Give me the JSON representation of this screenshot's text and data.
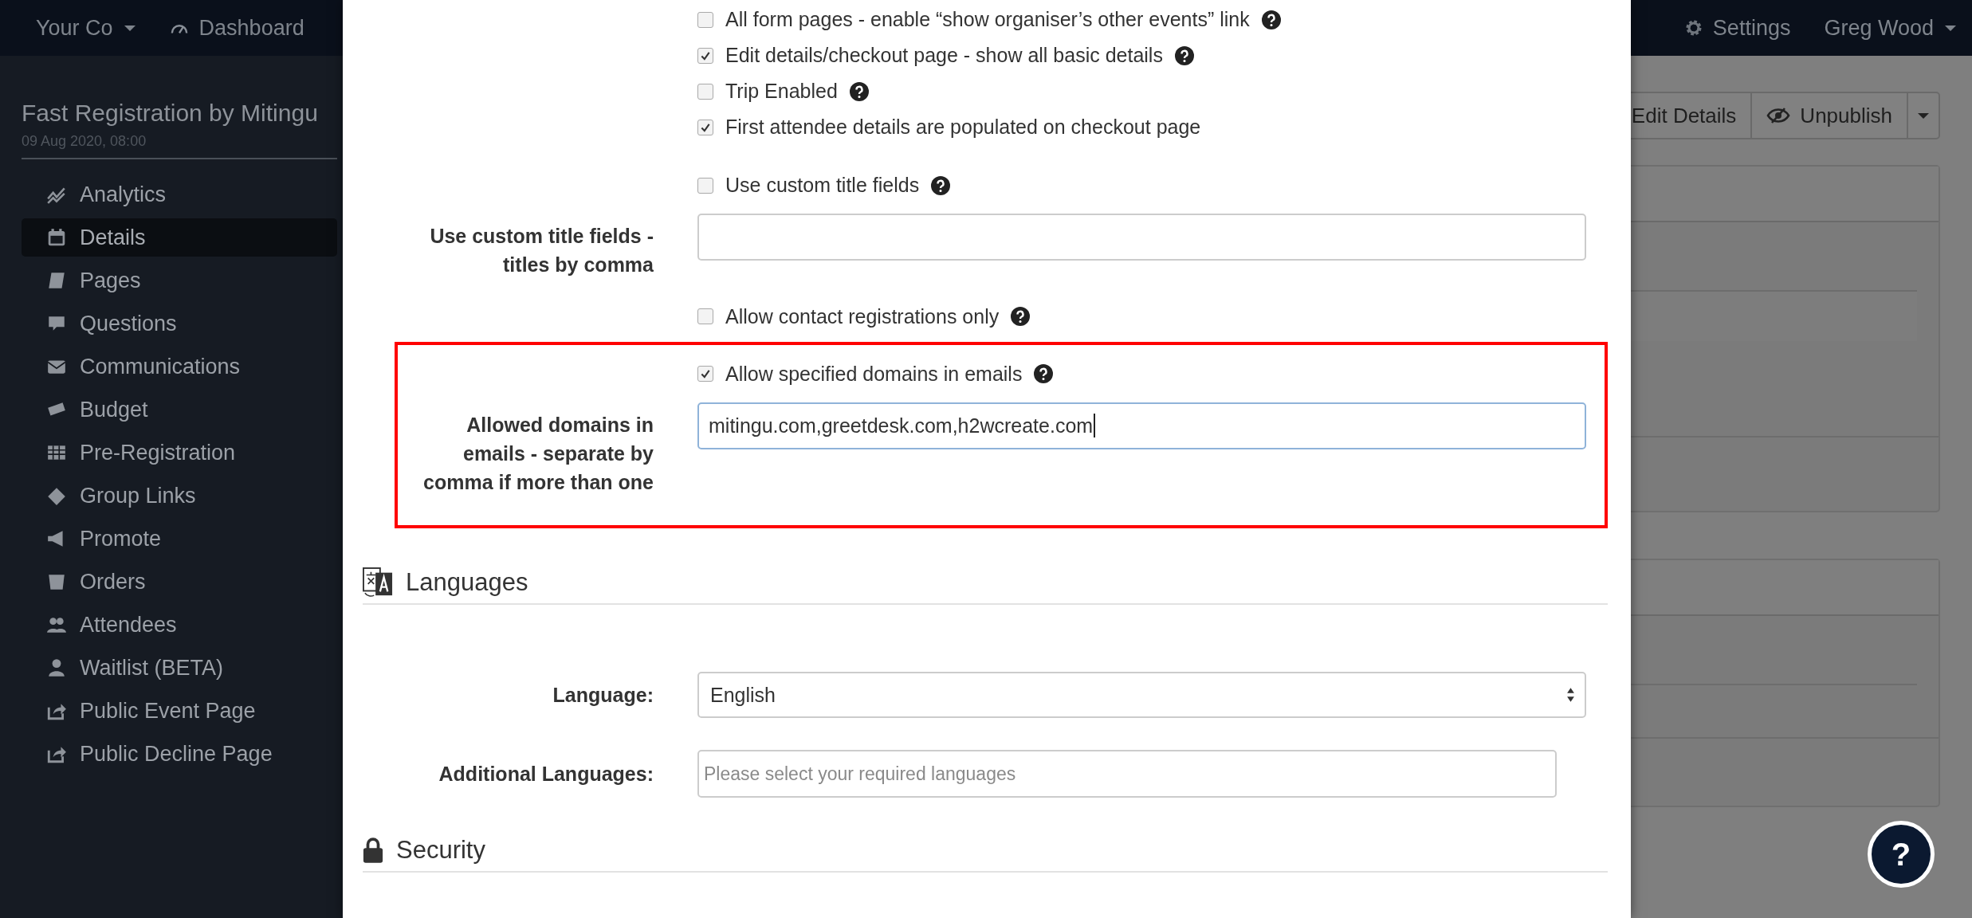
{
  "navbar": {
    "brand": "Your Co",
    "links": [
      {
        "label": "Dashboard"
      }
    ],
    "settings": "Settings",
    "user": "Greg Wood"
  },
  "sidebar": {
    "event_title": "Fast Registration by Mitingu",
    "event_date": "09 Aug 2020, 08:00",
    "items": [
      {
        "label": "Analytics",
        "selected": false
      },
      {
        "label": "Details",
        "selected": true
      },
      {
        "label": "Pages",
        "selected": false
      },
      {
        "label": "Questions",
        "selected": false
      },
      {
        "label": "Communications",
        "selected": false
      },
      {
        "label": "Budget",
        "selected": false
      },
      {
        "label": "Pre-Registration",
        "selected": false
      },
      {
        "label": "Group Links",
        "selected": false
      },
      {
        "label": "Promote",
        "selected": false
      },
      {
        "label": "Orders",
        "selected": false
      },
      {
        "label": "Attendees",
        "selected": false
      },
      {
        "label": "Waitlist (BETA)",
        "selected": false
      },
      {
        "label": "Public Event Page",
        "selected": false
      },
      {
        "label": "Public Decline Page",
        "selected": false
      }
    ]
  },
  "toolbar": {
    "buttons": [
      "Edit Details",
      "Unpublish"
    ]
  },
  "modal": {
    "groups": [
      {
        "highlighted": false,
        "fields": [
          {
            "kind": "checkbox",
            "label": "All form pages - enable “show organiser’s other events” link",
            "checked": false,
            "help": true
          },
          {
            "kind": "checkbox",
            "label": "Edit details/checkout page - show all basic details",
            "checked": true,
            "help": true
          },
          {
            "kind": "checkbox",
            "label": "Trip Enabled",
            "checked": false,
            "help": true
          },
          {
            "kind": "checkbox",
            "label": "First attendee details are populated on checkout page",
            "checked": true,
            "help": false
          }
        ]
      },
      {
        "highlighted": false,
        "fields": [
          {
            "kind": "checkbox",
            "label": "Use custom title fields",
            "checked": false,
            "help": true
          },
          {
            "kind": "text",
            "label": "Use custom title fields - titles by comma",
            "focused": false
          },
          {
            "kind": "checkbox",
            "label": "Allow contact registrations only",
            "checked": false,
            "help": true
          }
        ]
      },
      {
        "highlighted": true,
        "fields": [
          {
            "kind": "checkbox",
            "label": "Allow specified domains in emails",
            "checked": true,
            "help": true
          },
          {
            "kind": "text",
            "label": "Allowed domains in emails - separate by comma if more than one",
            "value": "mitingu.com,greetdesk.com,h2wcreate.com",
            "focused": true
          }
        ]
      }
    ],
    "sections": [
      {
        "kind": "languages",
        "title": "Languages",
        "fields": [
          {
            "kind": "select",
            "label": "Language:",
            "value": "English"
          },
          {
            "kind": "multiselect",
            "label": "Additional Languages:",
            "placeholder": "Please select your required languages"
          }
        ]
      },
      {
        "kind": "security",
        "title": "Security"
      }
    ]
  },
  "help_button": {
    "label": "?"
  }
}
